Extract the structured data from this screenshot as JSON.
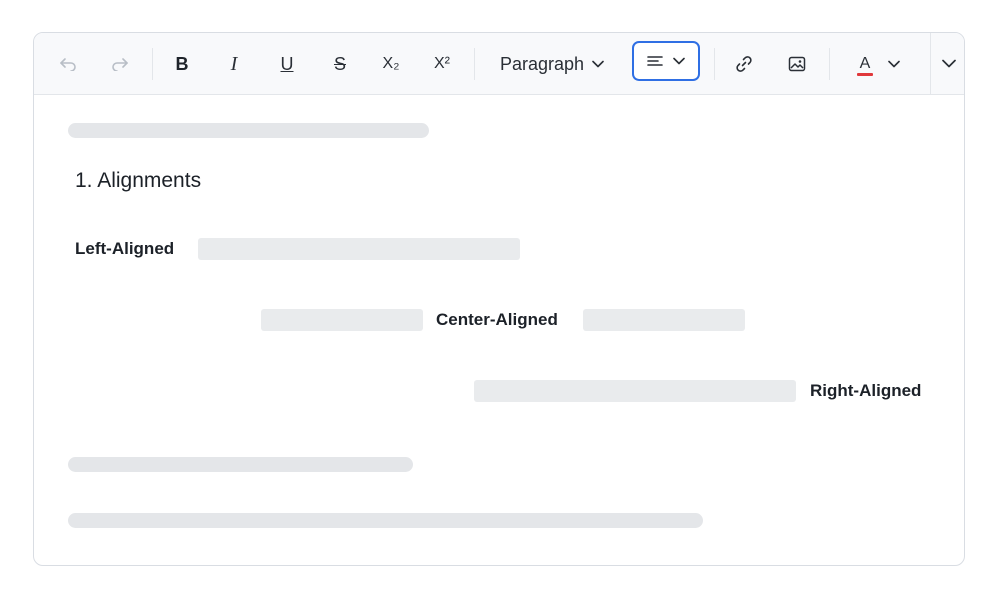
{
  "toolbar": {
    "undo_icon": "undo-icon",
    "redo_icon": "redo-icon",
    "bold_label": "B",
    "italic_label": "I",
    "underline_label": "U",
    "strike_label": "S",
    "subscript_label": "X₂",
    "superscript_label": "X²",
    "block_format_value": "Paragraph",
    "align_icon": "align-left-icon",
    "link_icon": "link-icon",
    "image_icon": "image-icon",
    "text_color_label": "A",
    "text_color_underline": "#e0383b",
    "accent_color": "#2f6fe4"
  },
  "document": {
    "heading": "1. Alignments",
    "left_aligned": "Left-Aligned",
    "center_aligned": "Center-Aligned",
    "right_aligned": "Right-Aligned"
  }
}
